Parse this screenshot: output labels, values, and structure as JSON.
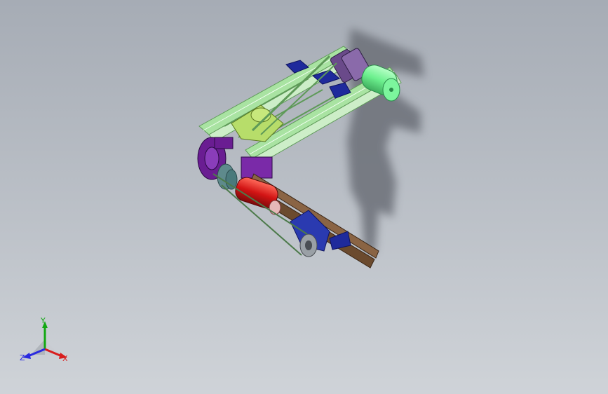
{
  "viewport": {
    "background_top": "#a6acb5",
    "background_bottom": "#cfd3d8"
  },
  "model": {
    "colors": {
      "frame": "#a9e3a2",
      "frame_dark": "#5e9a58",
      "motor": "#7cf59d",
      "stepper": "#6a4a8a",
      "bracket_blue": "#1f2a9c",
      "purple": "#6a1d92",
      "red": "#d21414",
      "rail": "#6b4a2e",
      "grey": "#9aa0a6",
      "shadow": "#6c7078"
    }
  },
  "triad": {
    "icon": "coordinate-triad-icon",
    "y_label": "Y",
    "z_label": "Z",
    "x_label": "X",
    "colors": {
      "x": "#d81d1d",
      "y": "#12a812",
      "z": "#2a2ae0"
    }
  }
}
